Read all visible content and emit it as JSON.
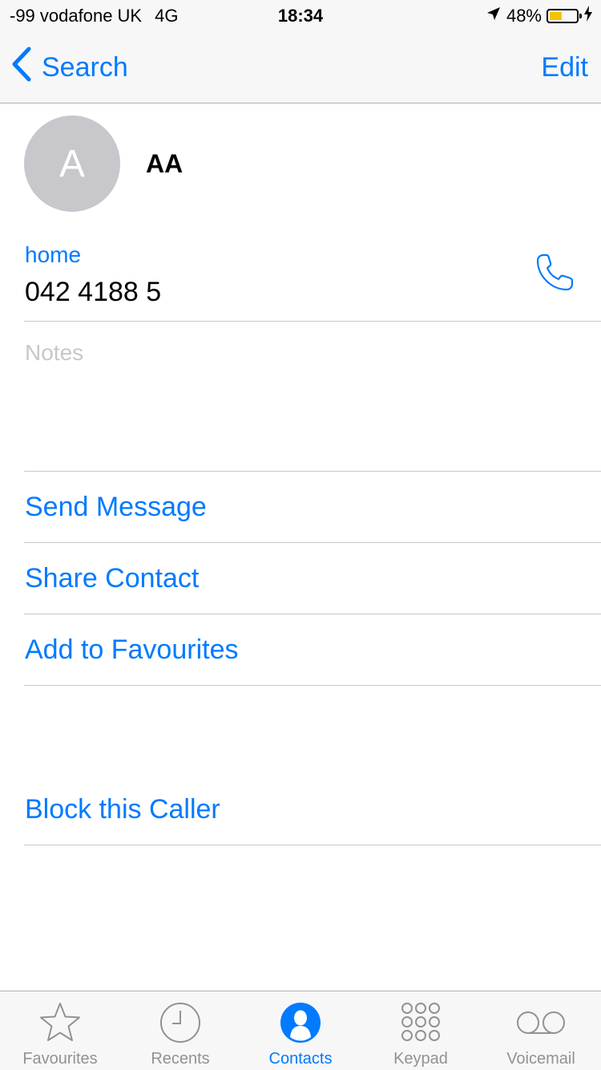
{
  "status_bar": {
    "carrier": "-99 vodafone UK",
    "network": "4G",
    "time": "18:34",
    "battery_percent": "48%",
    "battery_level": 0.48,
    "battery_color": "#f7c300"
  },
  "nav": {
    "back_label": "Search",
    "edit_label": "Edit"
  },
  "contact": {
    "initial": "A",
    "name": "AA",
    "phone_label": "home",
    "phone_number": "042 4188 5"
  },
  "notes": {
    "label": "Notes"
  },
  "actions": {
    "send_message": "Send Message",
    "share_contact": "Share Contact",
    "add_favourites": "Add to Favourites",
    "block_caller": "Block this Caller"
  },
  "tabs": [
    {
      "label": "Favourites",
      "icon": "star-icon",
      "active": false
    },
    {
      "label": "Recents",
      "icon": "clock-icon",
      "active": false
    },
    {
      "label": "Contacts",
      "icon": "contacts-icon",
      "active": true
    },
    {
      "label": "Keypad",
      "icon": "keypad-icon",
      "active": false
    },
    {
      "label": "Voicemail",
      "icon": "voicemail-icon",
      "active": false
    }
  ],
  "colors": {
    "accent": "#007aff",
    "inactive_tab": "#929292",
    "avatar_bg": "#c7c7cc"
  }
}
